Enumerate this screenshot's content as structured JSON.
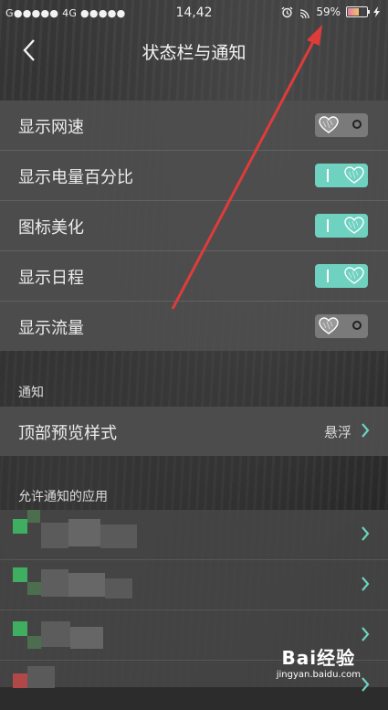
{
  "status_bar": {
    "carrier_text": "G●●●●● 4G ●●●●●",
    "time": "14,42",
    "battery_percent_text": "59%",
    "battery_level": 0.59,
    "icons": [
      "alarm-icon",
      "wifi-icon",
      "battery-icon",
      "charging-icon"
    ]
  },
  "header": {
    "title": "状态栏与通知",
    "back_icon": "chevron-left-icon"
  },
  "settings": [
    {
      "label": "显示网速",
      "on": false
    },
    {
      "label": "显示电量百分比",
      "on": true
    },
    {
      "label": "图标美化",
      "on": true
    },
    {
      "label": "显示日程",
      "on": true
    },
    {
      "label": "显示流量",
      "on": false
    }
  ],
  "notification_section": {
    "title": "通知",
    "preview_label": "顶部预览样式",
    "preview_value": "悬浮"
  },
  "apps_section": {
    "title": "允许通知的应用"
  },
  "watermark": {
    "main": "Bai经验",
    "sub": "jingyan.baidu.com"
  },
  "colors": {
    "toggle_on": "#6fd1c0",
    "toggle_off": "#7a7a7a",
    "chevron": "#6fd1c0",
    "annotation_arrow": "#e03b3b"
  }
}
